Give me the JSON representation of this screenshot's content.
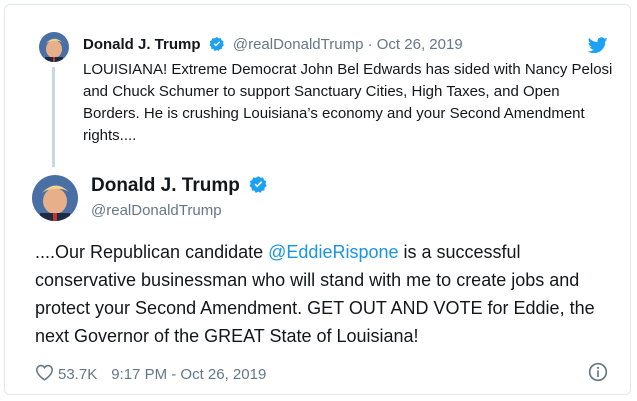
{
  "parent_tweet": {
    "name": "Donald J. Trump",
    "handle": "@realDonaldTrump",
    "separator": "·",
    "date": "Oct 26, 2019",
    "text": "LOUISIANA! Extreme Democrat John Bel Edwards has sided with Nancy Pelosi and Chuck Schumer to support Sanctuary Cities, High Taxes, and Open Borders. He is crushing Louisiana’s economy and your Second Amendment rights....",
    "icons": [
      "avatar",
      "verified-badge-icon",
      "twitter-bird-icon"
    ]
  },
  "main_tweet": {
    "name": "Donald J. Trump",
    "handle": "@realDonaldTrump",
    "text_before_mention": "....Our Republican candidate ",
    "mention": "@EddieRispone",
    "text_after_mention": " is a successful conservative businessman who will stand with me to create jobs and protect your Second Amendment. GET OUT AND VOTE for Eddie, the next Governor of the GREAT State of Louisiana!",
    "likes": "53.7K",
    "timestamp": "9:17 PM - Oct 26, 2019",
    "icons": [
      "avatar",
      "verified-badge-icon",
      "heart-icon",
      "info-icon"
    ]
  },
  "colors": {
    "verified": "#1da1f2",
    "mention": "#1b95e0",
    "meta": "#657786",
    "text": "#14171a",
    "border": "#e1e8ed"
  }
}
